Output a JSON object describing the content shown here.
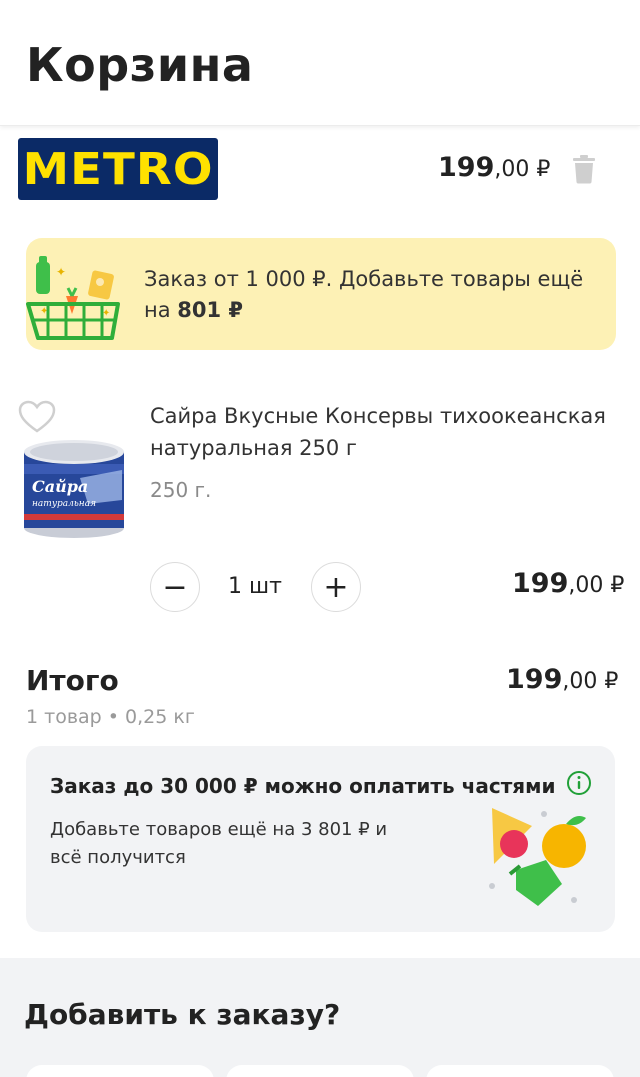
{
  "header": {
    "title": "Корзина"
  },
  "store": {
    "logo_text": "METRO",
    "total_main": "199",
    "total_fraction": ",00 ₽",
    "logo_bg": "#0b2a66",
    "logo_fg": "#ffe100"
  },
  "promo": {
    "text_before": "Заказ от 1 000 ₽. Добавьте товары ещё на ",
    "amount": "801 ₽",
    "bg": "#fdf1b5"
  },
  "product": {
    "name": "Сайра Вкусные Консервы тихоокеанская натуральная 250 г",
    "weight": "250 г.",
    "quantity": "1 шт",
    "minus_label": "−",
    "plus_label": "+",
    "price_main": "199",
    "price_fraction": ",00 ₽",
    "can_label_top": "Сайра",
    "can_label_bottom": "натуральная"
  },
  "summary": {
    "label": "Итого",
    "subtitle": "1 товар • 0,25 кг",
    "price_main": "199",
    "price_fraction": ",00 ₽"
  },
  "installments": {
    "title": "Заказ до 30 000 ₽ можно оплатить частями",
    "text": "Добавьте товаров ещё на 3 801 ₽ и всё получится",
    "accent": "#21a038"
  },
  "suggestions": {
    "title": "Добавить к заказу?"
  }
}
